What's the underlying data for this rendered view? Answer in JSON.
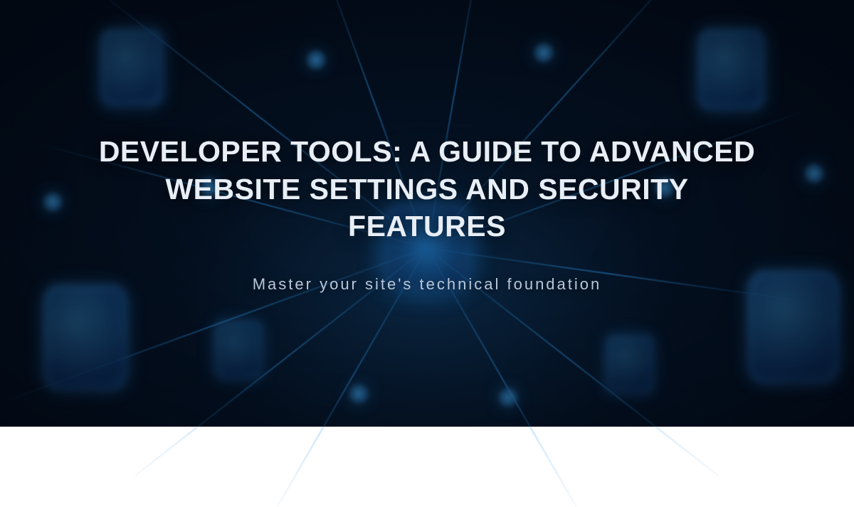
{
  "hero": {
    "title": "DEVELOPER TOOLS: A GUIDE TO ADVANCED WEBSITE SETTINGS AND SECURITY FEATURES",
    "subtitle": "Master your site's technical foundation"
  },
  "colors": {
    "accent": "#32a0f0",
    "text_primary": "#e8eef5",
    "text_secondary": "#b8c7d9",
    "bg_dark": "#020812"
  }
}
